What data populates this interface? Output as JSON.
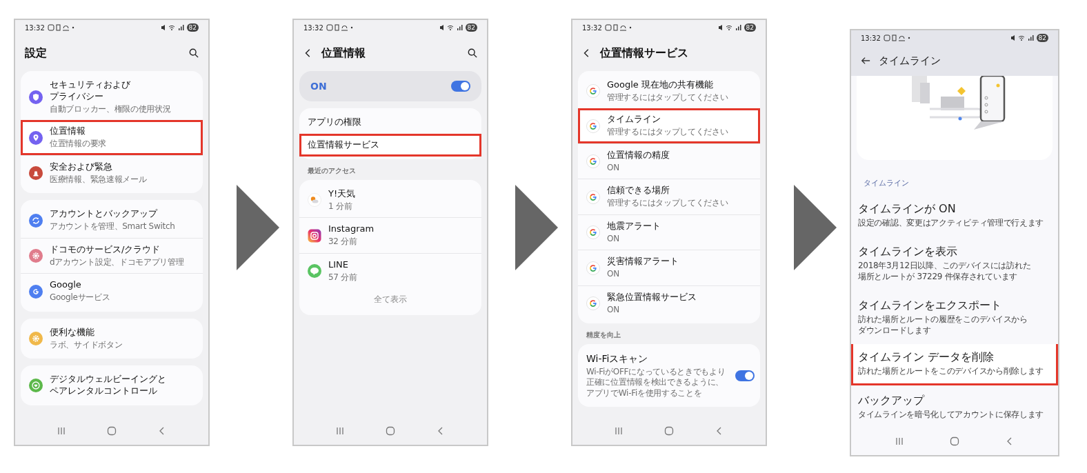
{
  "screens": [
    {
      "kind": "oneui",
      "status": {
        "time": "13:32",
        "battery": "82"
      },
      "header": {
        "title": "設定",
        "back": false,
        "search": true
      },
      "blocks": [
        {
          "kind": "card",
          "items": [
            {
              "title": [
                "セキュリティおよび",
                "プライバシー"
              ],
              "subtitle": "自動ブロッカー、権限の使用状況",
              "kind": "shield",
              "color": "#7462f0",
              "highlighted": false
            },
            {
              "title": "位置情報",
              "subtitle": "位置情報の要求",
              "kind": "pin",
              "color": "#7462f0",
              "highlighted": true
            },
            {
              "title": "安全および緊急",
              "subtitle": "医療情報、緊急速報メール",
              "kind": "alert",
              "color": "#c84a3c",
              "highlighted": false
            }
          ]
        },
        {
          "kind": "card",
          "items": [
            {
              "title": "アカウントとバックアップ",
              "subtitle": "アカウントを管理、Smart Switch",
              "kind": "sync",
              "color": "#4f7ff0",
              "highlighted": false
            },
            {
              "title": "ドコモのサービス/クラウド",
              "subtitle": "dアカウント設定、ドコモアプリ管理",
              "kind": "gear",
              "color": "#e07c8c",
              "highlighted": false
            },
            {
              "title": "Google",
              "subtitle": "Googleサービス",
              "kind": "g",
              "color": "#4f7ff0",
              "highlighted": false
            }
          ]
        },
        {
          "kind": "card",
          "items": [
            {
              "title": "便利な機能",
              "subtitle": "ラボ、サイドボタン",
              "kind": "gear",
              "color": "#f0b84a",
              "highlighted": false
            }
          ]
        },
        {
          "kind": "card",
          "items": [
            {
              "title": [
                "デジタルウェルビーイングと",
                "ペアレンタルコントロール"
              ],
              "kind": "heart",
              "color": "#5cb84a",
              "highlighted": false
            }
          ]
        }
      ]
    },
    {
      "kind": "oneui",
      "status": {
        "time": "13:32",
        "battery": "82"
      },
      "header": {
        "title": "位置情報",
        "back": true,
        "search": true
      },
      "blocks": [
        {
          "kind": "toggle_card",
          "label": "ON",
          "on": true
        },
        {
          "kind": "card",
          "items": [
            {
              "title": "アプリの権限",
              "highlighted": false
            },
            {
              "title": "位置情報サービス",
              "highlighted": true
            }
          ]
        },
        {
          "kind": "section",
          "label": "最近のアクセス"
        },
        {
          "kind": "card",
          "items": [
            {
              "title": "Y!天気",
              "subtitle": "1 分前",
              "kind": "weather",
              "highlighted": false
            },
            {
              "title": "Instagram",
              "subtitle": "32 分前",
              "kind": "instagram",
              "highlighted": false
            },
            {
              "title": "LINE",
              "subtitle": "57 分前",
              "kind": "line",
              "highlighted": false
            }
          ],
          "footer": "全て表示"
        }
      ]
    },
    {
      "kind": "oneui",
      "status": {
        "time": "13:32",
        "battery": "82"
      },
      "header": {
        "title": "位置情報サービス",
        "back": true,
        "search": false
      },
      "blocks": [
        {
          "kind": "card",
          "items": [
            {
              "title": "Google 現在地の共有機能",
              "subtitle": "管理するにはタップしてください",
              "kind": "google",
              "highlighted": false
            },
            {
              "title": "タイムライン",
              "subtitle": "管理するにはタップしてください",
              "kind": "google",
              "highlighted": true
            },
            {
              "title": "位置情報の精度",
              "subtitle": "ON",
              "kind": "google",
              "highlighted": false
            },
            {
              "title": "信頼できる場所",
              "subtitle": "管理するにはタップしてください",
              "kind": "google",
              "highlighted": false
            },
            {
              "title": "地震アラート",
              "subtitle": "ON",
              "kind": "google",
              "highlighted": false
            },
            {
              "title": "災害情報アラート",
              "subtitle": "ON",
              "kind": "google",
              "highlighted": false
            },
            {
              "title": "緊急位置情報サービス",
              "subtitle": "ON",
              "kind": "google",
              "highlighted": false
            }
          ]
        },
        {
          "kind": "section",
          "label": "精度を向上"
        },
        {
          "kind": "toggle_item_card",
          "title": "Wi-Fiスキャン",
          "description": [
            "Wi-FiがOFFになっているときでもより",
            "正確に位置情報を検出できるように、",
            "アプリでWi-Fiを使用することを"
          ],
          "on": true
        }
      ]
    },
    {
      "kind": "material",
      "status": {
        "time": "13:32",
        "battery": "82"
      },
      "header": {
        "title": "タイムライン",
        "back": true,
        "search": false
      },
      "blocks": [
        {
          "kind": "illustration"
        },
        {
          "kind": "section",
          "label": "タイムライン"
        },
        {
          "kind": "list",
          "items": [
            {
              "title": "タイムラインが ON",
              "subtitle": "設定の確認、変更はアクティビティ管理で行えます",
              "highlighted": false
            },
            {
              "title": "タイムラインを表示",
              "subtitle": [
                "2018年3月12日以降、このデバイスには訪れた",
                "場所とルートが 37229 件保存されています"
              ],
              "highlighted": false
            },
            {
              "title": "タイムラインをエクスポート",
              "subtitle": [
                "訪れた場所とルートの履歴をこのデバイスから",
                "ダウンロードします"
              ],
              "highlighted": false
            },
            {
              "title": "タイムライン データを削除",
              "subtitle": "訪れた場所とルートをこのデバイスから削除します",
              "highlighted": true
            },
            {
              "title": "バックアップ",
              "subtitle": "タイムラインを暗号化してアカウントに保存します",
              "highlighted": false
            }
          ]
        }
      ]
    }
  ]
}
